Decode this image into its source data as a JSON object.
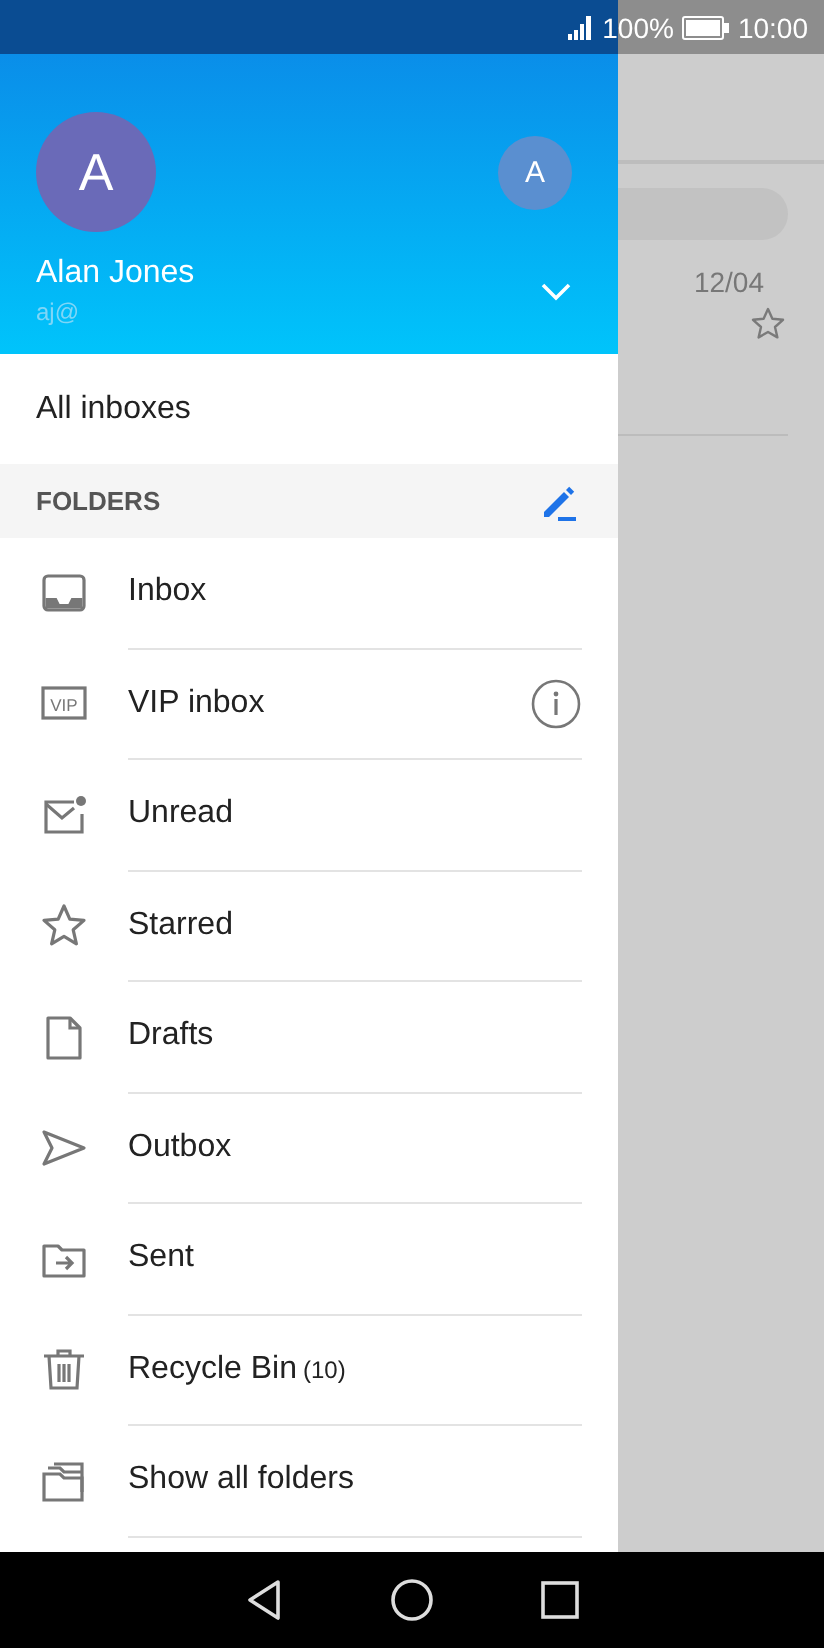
{
  "status_bar": {
    "battery": "100%",
    "time": "10:00"
  },
  "account": {
    "initial": "A",
    "name": "Alan Jones",
    "email": "aj@",
    "other_account_initial": "A"
  },
  "all_inboxes": "All inboxes",
  "folders_heading": "FOLDERS",
  "folders": [
    {
      "kind": "inbox",
      "label": "Inbox",
      "info": false
    },
    {
      "kind": "vip",
      "label": "VIP inbox",
      "icon_text": "VIP",
      "info": true
    },
    {
      "kind": "unread",
      "label": "Unread",
      "info": false
    },
    {
      "kind": "starred",
      "label": "Starred",
      "info": false
    },
    {
      "kind": "drafts",
      "label": "Drafts",
      "info": false
    },
    {
      "kind": "outbox",
      "label": "Outbox",
      "info": false
    },
    {
      "kind": "sent",
      "label": "Sent",
      "info": false
    },
    {
      "kind": "bin",
      "label": "Recycle Bin",
      "count": "(10)",
      "info": false
    },
    {
      "kind": "all",
      "label": "Show all folders",
      "info": false
    }
  ],
  "background_list": {
    "date": "12/04"
  }
}
